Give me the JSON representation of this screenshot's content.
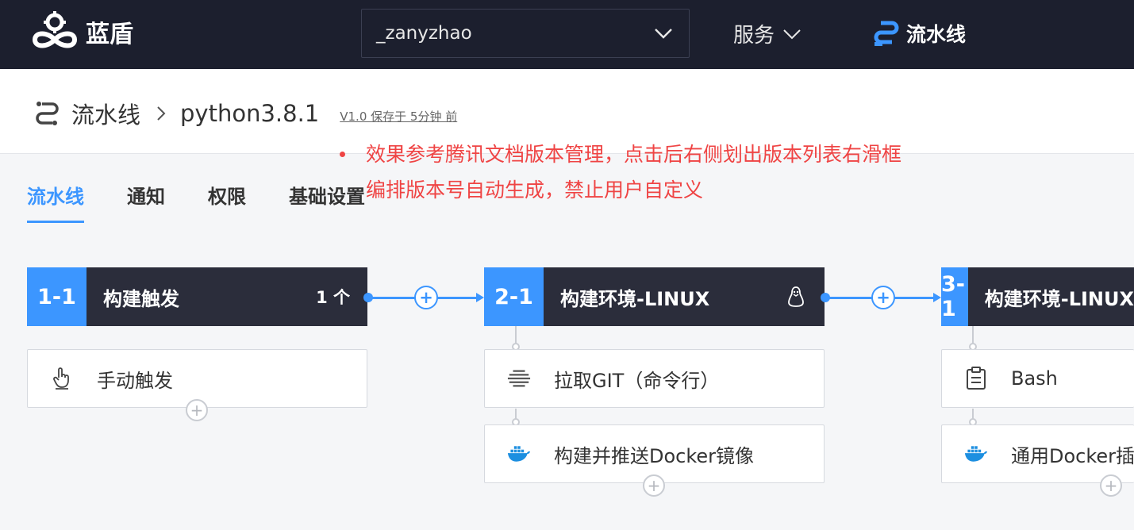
{
  "header": {
    "logo_text": "蓝盾",
    "project": "_zanyzhao",
    "services_label": "服务",
    "pipeline_label": "流水线"
  },
  "breadcrumb": {
    "root": "流水线",
    "pipeline_name": "python3.8.1",
    "version_info": "V1.0 保存于 5分钟 前"
  },
  "annotation": {
    "line1": "效果参考腾讯文档版本管理，点击后右侧划出版本列表右滑框",
    "line2": "编排版本号自动生成，禁止用户自定义"
  },
  "tabs": [
    "流水线",
    "通知",
    "权限",
    "基础设置"
  ],
  "stages": [
    {
      "num": "1-1",
      "name": "构建触发",
      "extra": "1 个",
      "jobs": [
        "手动触发"
      ]
    },
    {
      "num": "2-1",
      "name": "构建环境-LINUX",
      "jobs": [
        "拉取GIT（命令行）",
        "构建并推送Docker镜像"
      ]
    },
    {
      "num": "3-1",
      "name": "构建环境-LINUX",
      "jobs": [
        "Bash",
        "通用Docker插件"
      ]
    }
  ],
  "colors": {
    "accent": "#3c96ff",
    "topbar": "#1c1f2e",
    "stage_head": "#2b2d3b",
    "annotation": "#ef4444"
  }
}
